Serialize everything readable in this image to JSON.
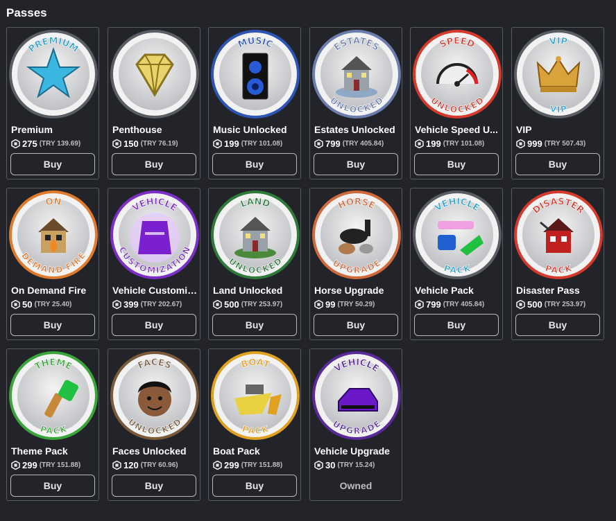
{
  "page_title": "Passes",
  "passes": [
    {
      "name": "Premium",
      "price": "275",
      "local_price": "(TRY 139.69)",
      "button": "Buy",
      "badge_top": "PREMIUM",
      "badge_bottom": "",
      "ring": "#5a5d63",
      "icon": "star-icon"
    },
    {
      "name": "Penthouse",
      "price": "150",
      "local_price": "(TRY 76.19)",
      "button": "Buy",
      "badge_top": "",
      "badge_bottom": "",
      "ring": "#5a5d63",
      "icon": "diamond-icon"
    },
    {
      "name": "Music Unlocked",
      "price": "199",
      "local_price": "(TRY 101.08)",
      "button": "Buy",
      "badge_top": "MUSIC",
      "badge_bottom": "",
      "ring": "#2e55b5",
      "icon": "speaker-icon"
    },
    {
      "name": "Estates Unlocked",
      "price": "799",
      "local_price": "(TRY 405.84)",
      "button": "Buy",
      "badge_top": "ESTATES",
      "badge_bottom": "UNLOCKED",
      "ring": "#6b7dad",
      "icon": "house-icon"
    },
    {
      "name": "Vehicle Speed U...",
      "price": "199",
      "local_price": "(TRY 101.08)",
      "button": "Buy",
      "badge_top": "SPEED",
      "badge_bottom": "UNLOCKED",
      "ring": "#d63a2c",
      "icon": "speedometer-icon"
    },
    {
      "name": "VIP",
      "price": "999",
      "local_price": "(TRY 507.43)",
      "button": "Buy",
      "badge_top": "VIP",
      "badge_bottom": "VIP",
      "ring": "#5a5d63",
      "icon": "crown-icon"
    },
    {
      "name": "On Demand Fire",
      "price": "50",
      "local_price": "(TRY 25.40)",
      "button": "Buy",
      "badge_top": "ON",
      "badge_bottom": "DEMAND FIRE",
      "ring": "#e07a2c",
      "icon": "burning-house-icon"
    },
    {
      "name": "Vehicle Customiz...",
      "price": "399",
      "local_price": "(TRY 202.67)",
      "button": "Buy",
      "badge_top": "VEHICLE",
      "badge_bottom": "CUSTOMIZATION",
      "ring": "#7b2fc6",
      "icon": "car-icon"
    },
    {
      "name": "Land Unlocked",
      "price": "500",
      "local_price": "(TRY 253.97)",
      "button": "Buy",
      "badge_top": "LAND",
      "badge_bottom": "UNLOCKED",
      "ring": "#2f7a3a",
      "icon": "land-house-icon"
    },
    {
      "name": "Horse Upgrade",
      "price": "99",
      "local_price": "(TRY 50.29)",
      "button": "Buy",
      "badge_top": "HORSE",
      "badge_bottom": "UPGRADE",
      "ring": "#d06a3c",
      "icon": "horse-icon"
    },
    {
      "name": "Vehicle Pack",
      "price": "799",
      "local_price": "(TRY 405.84)",
      "button": "Buy",
      "badge_top": "VEHICLE",
      "badge_bottom": "PACK",
      "ring": "#5a5d63",
      "icon": "vehicles-icon"
    },
    {
      "name": "Disaster Pass",
      "price": "500",
      "local_price": "(TRY 253.97)",
      "button": "Buy",
      "badge_top": "DISASTER",
      "badge_bottom": "PACK",
      "ring": "#d63a2c",
      "icon": "damaged-house-icon"
    },
    {
      "name": "Theme Pack",
      "price": "299",
      "local_price": "(TRY 151.88)",
      "button": "Buy",
      "badge_top": "THEME",
      "badge_bottom": "PACK",
      "ring": "#3aa53a",
      "icon": "paintbrush-icon"
    },
    {
      "name": "Faces Unlocked",
      "price": "120",
      "local_price": "(TRY 60.96)",
      "button": "Buy",
      "badge_top": "FACES",
      "badge_bottom": "UNLOCKED",
      "ring": "#7a5a3a",
      "icon": "face-icon"
    },
    {
      "name": "Boat Pack",
      "price": "299",
      "local_price": "(TRY 151.88)",
      "button": "Buy",
      "badge_top": "BOAT",
      "badge_bottom": "PACK",
      "ring": "#e0a020",
      "icon": "boat-icon"
    },
    {
      "name": "Vehicle Upgrade",
      "price": "30",
      "local_price": "(TRY 15.24)",
      "button": "Owned",
      "owned": true,
      "badge_top": "VEHICLE",
      "badge_bottom": "UPGRADE",
      "ring": "#5a2a9a",
      "icon": "purple-car-icon"
    }
  ],
  "currency_icon": "robux-icon"
}
